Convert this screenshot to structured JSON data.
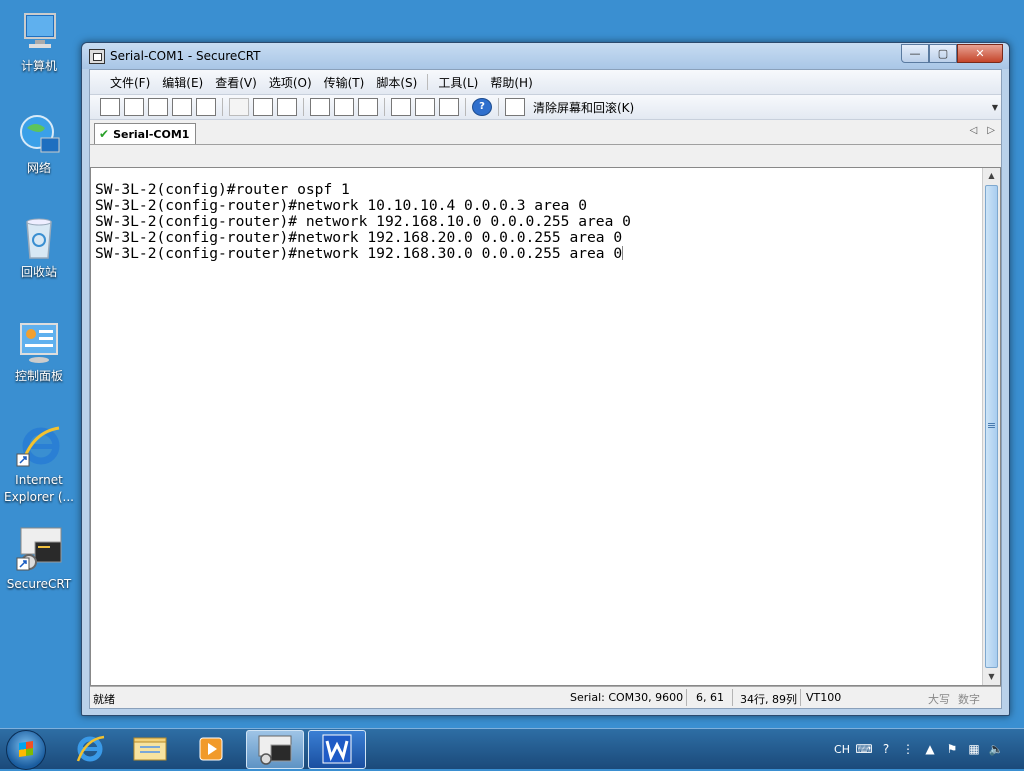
{
  "desktop": {
    "icons": [
      {
        "label": "计算机"
      },
      {
        "label": "网络"
      },
      {
        "label": "回收站"
      },
      {
        "label": "控制面板"
      },
      {
        "label": "Internet Explorer (..."
      },
      {
        "label": "SecureCRT"
      }
    ]
  },
  "window": {
    "title": "Serial-COM1 - SecureCRT",
    "min_glyph": "—",
    "max_glyph": "▢",
    "close_glyph": "✕"
  },
  "menu": {
    "file": "文件(F)",
    "edit": "编辑(E)",
    "view": "查看(V)",
    "options": "选项(O)",
    "transfer": "传输(T)",
    "script": "脚本(S)",
    "tools": "工具(L)",
    "help": "帮助(H)"
  },
  "toolbar": {
    "clear_screen_label": "清除屏幕和回滚(K)"
  },
  "tab": {
    "label": "Serial-COM1"
  },
  "terminal": {
    "lines": [
      "SW-3L-2(config)#router ospf 1",
      "SW-3L-2(config-router)#network 10.10.10.4 0.0.0.3 area 0",
      "SW-3L-2(config-router)# network 192.168.10.0 0.0.0.255 area 0",
      "SW-3L-2(config-router)#network 192.168.20.0 0.0.0.255 area 0",
      "SW-3L-2(config-router)#network 192.168.30.0 0.0.0.255 area 0"
    ]
  },
  "status": {
    "ready": "就绪",
    "connection": "Serial: COM30, 9600",
    "cursor_pos": "6,  61",
    "size": "34行, 89列",
    "emulation": "VT100",
    "caps": "大写",
    "num": "数字"
  },
  "taskbar": {
    "tray_lang": "CH"
  }
}
